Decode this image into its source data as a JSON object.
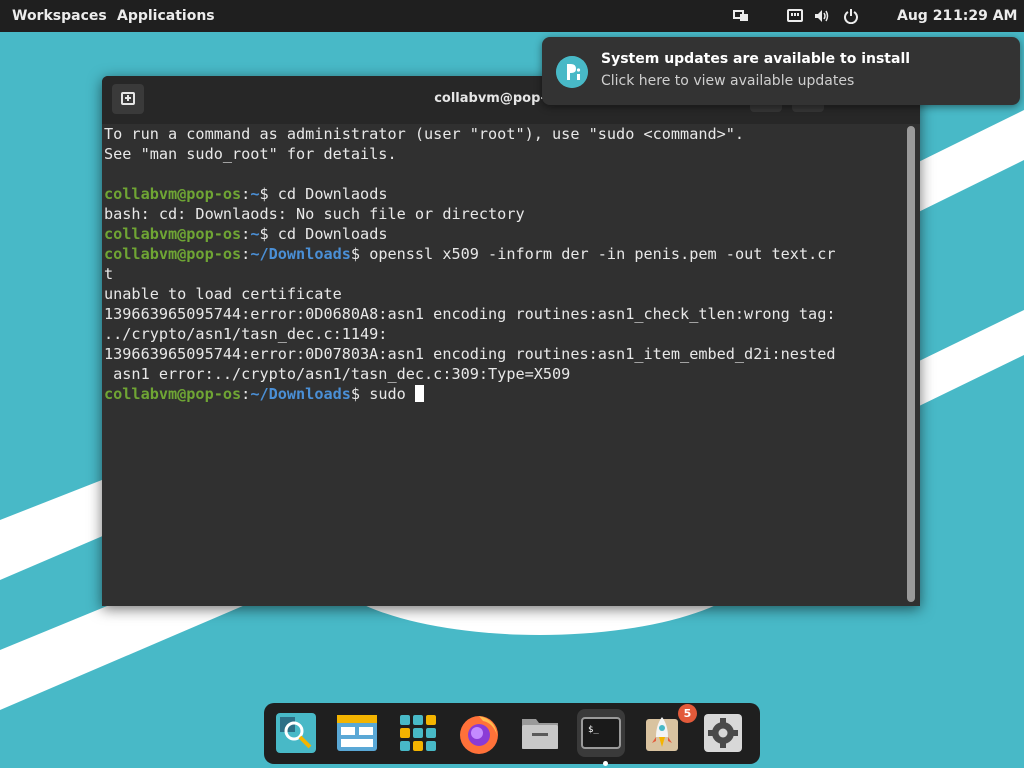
{
  "topbar": {
    "workspaces_label": "Workspaces",
    "applications_label": "Applications",
    "date": "Aug 21",
    "time": "1:29 AM",
    "icons": [
      "display-icon",
      "network-icon",
      "volume-icon",
      "power-icon"
    ]
  },
  "notification": {
    "title": "System updates are available to install",
    "body": "Click here to view available updates",
    "icon": "pop-os-logo-icon"
  },
  "terminal": {
    "title": "collabvm@pop-os: ~/",
    "lines": [
      [
        {
          "t": "To run a command as administrator (user \"root\"), use \"sudo <command>\".",
          "c": ""
        }
      ],
      [
        {
          "t": "See \"man sudo_root\" for details.",
          "c": ""
        }
      ],
      [
        {
          "t": "",
          "c": ""
        }
      ],
      [
        {
          "t": "collabvm@pop-os",
          "c": "user"
        },
        {
          "t": ":",
          "c": ""
        },
        {
          "t": "~",
          "c": "path"
        },
        {
          "t": "$ cd Downlaods",
          "c": ""
        }
      ],
      [
        {
          "t": "bash: cd: Downlaods: No such file or directory",
          "c": ""
        }
      ],
      [
        {
          "t": "collabvm@pop-os",
          "c": "user"
        },
        {
          "t": ":",
          "c": ""
        },
        {
          "t": "~",
          "c": "path"
        },
        {
          "t": "$ cd Downloads",
          "c": ""
        }
      ],
      [
        {
          "t": "collabvm@pop-os",
          "c": "user"
        },
        {
          "t": ":",
          "c": ""
        },
        {
          "t": "~/Downloads",
          "c": "path"
        },
        {
          "t": "$ openssl x509 -inform der -in penis.pem -out text.cr",
          "c": ""
        }
      ],
      [
        {
          "t": "t",
          "c": ""
        }
      ],
      [
        {
          "t": "unable to load certificate",
          "c": ""
        }
      ],
      [
        {
          "t": "139663965095744:error:0D0680A8:asn1 encoding routines:asn1_check_tlen:wrong tag:",
          "c": ""
        }
      ],
      [
        {
          "t": "../crypto/asn1/tasn_dec.c:1149:",
          "c": ""
        }
      ],
      [
        {
          "t": "139663965095744:error:0D07803A:asn1 encoding routines:asn1_item_embed_d2i:nested",
          "c": ""
        }
      ],
      [
        {
          "t": " asn1 error:../crypto/asn1/tasn_dec.c:309:Type=X509",
          "c": ""
        }
      ],
      [
        {
          "t": "collabvm@pop-os",
          "c": "user"
        },
        {
          "t": ":",
          "c": ""
        },
        {
          "t": "~/Downloads",
          "c": "path"
        },
        {
          "t": "$ sudo ",
          "c": ""
        }
      ]
    ]
  },
  "dock": {
    "items": [
      {
        "name": "search-icon",
        "label": "Search"
      },
      {
        "name": "workspaces-icon",
        "label": "Workspaces"
      },
      {
        "name": "app-grid-icon",
        "label": "Applications"
      },
      {
        "name": "firefox-icon",
        "label": "Firefox"
      },
      {
        "name": "files-icon",
        "label": "Files"
      },
      {
        "name": "terminal-icon",
        "label": "Terminal"
      },
      {
        "name": "pop-shop-icon",
        "label": "Pop!_Shop"
      },
      {
        "name": "settings-icon",
        "label": "Settings"
      }
    ],
    "active_index": 5,
    "shop_badge": "5"
  },
  "colors": {
    "wallpaper": "#48b9c7",
    "prompt_user": "#6fa534",
    "prompt_path": "#4a8fd6",
    "panel": "#1f1f1f"
  }
}
